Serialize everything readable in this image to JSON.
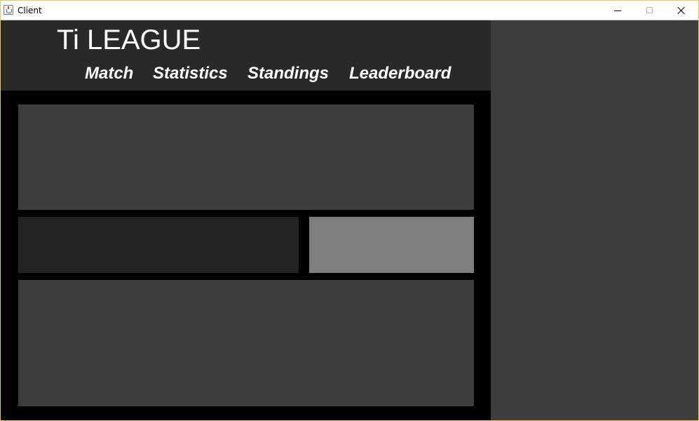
{
  "window": {
    "title": "Client"
  },
  "header": {
    "brand": "Ti LEAGUE",
    "nav": [
      {
        "label": "Match"
      },
      {
        "label": "Statistics"
      },
      {
        "label": "Standings"
      },
      {
        "label": "Leaderboard"
      }
    ]
  },
  "colors": {
    "header_bg": "#292929",
    "content_bg": "#000000",
    "panel": "#3d3d3d",
    "panel_dark": "#232323",
    "panel_light": "#7e7e7e",
    "side_panel": "#3d3d3d",
    "text": "#ffffff"
  },
  "icons": {
    "app": "java-icon",
    "minimize": "minimize-icon",
    "maximize": "maximize-icon",
    "close": "close-icon"
  }
}
